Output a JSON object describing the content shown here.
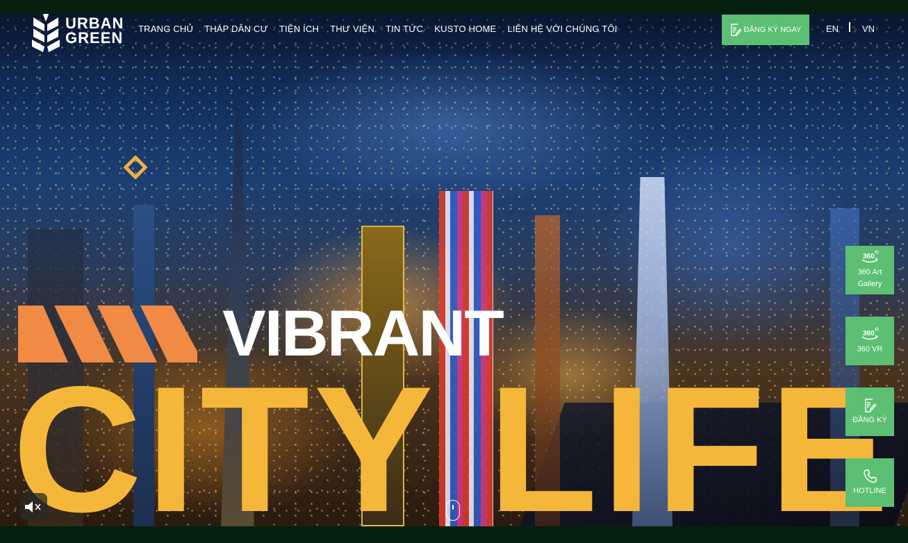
{
  "brand": {
    "logo_line1": "URBAN",
    "logo_line2": "GREEN",
    "logo_icon": "wheat-leaf-icon"
  },
  "nav": {
    "items": [
      {
        "label": "TRANG CHỦ"
      },
      {
        "label": "THÁP DÂN CƯ"
      },
      {
        "label": "TIỆN ÍCH"
      },
      {
        "label": "THƯ VIỆN"
      },
      {
        "label": "TIN TỨC"
      },
      {
        "label": "KUSTO HOME"
      },
      {
        "label": "LIÊN HỆ VỚI CHÚNG TÔI"
      }
    ]
  },
  "header": {
    "register_label": "ĐĂNG KÝ NGAY",
    "register_icon": "form-edit-icon",
    "lang_en": "EN",
    "lang_vn": "VN"
  },
  "hero": {
    "headline_small": "VIBRANT",
    "headline_large": "CITY LIFE",
    "background": "night-city-aerial-video"
  },
  "side_actions": {
    "art_gallery_line1": "360 Art",
    "art_gallery_line2": "Gallery",
    "vr_label": "360 VR",
    "register_label": "ĐĂNG KÝ",
    "hotline_label": "HOTLINE"
  },
  "controls": {
    "mute_icon": "speaker-muted-icon",
    "scroll_icon": "mouse-scroll-icon"
  },
  "colors": {
    "accent_green": "#5cbf73",
    "headline_yellow": "#f5b73a",
    "stripe_orange": "#f08a45",
    "diamond_gold": "#f0b040",
    "frame_dark_green": "#05200f"
  }
}
